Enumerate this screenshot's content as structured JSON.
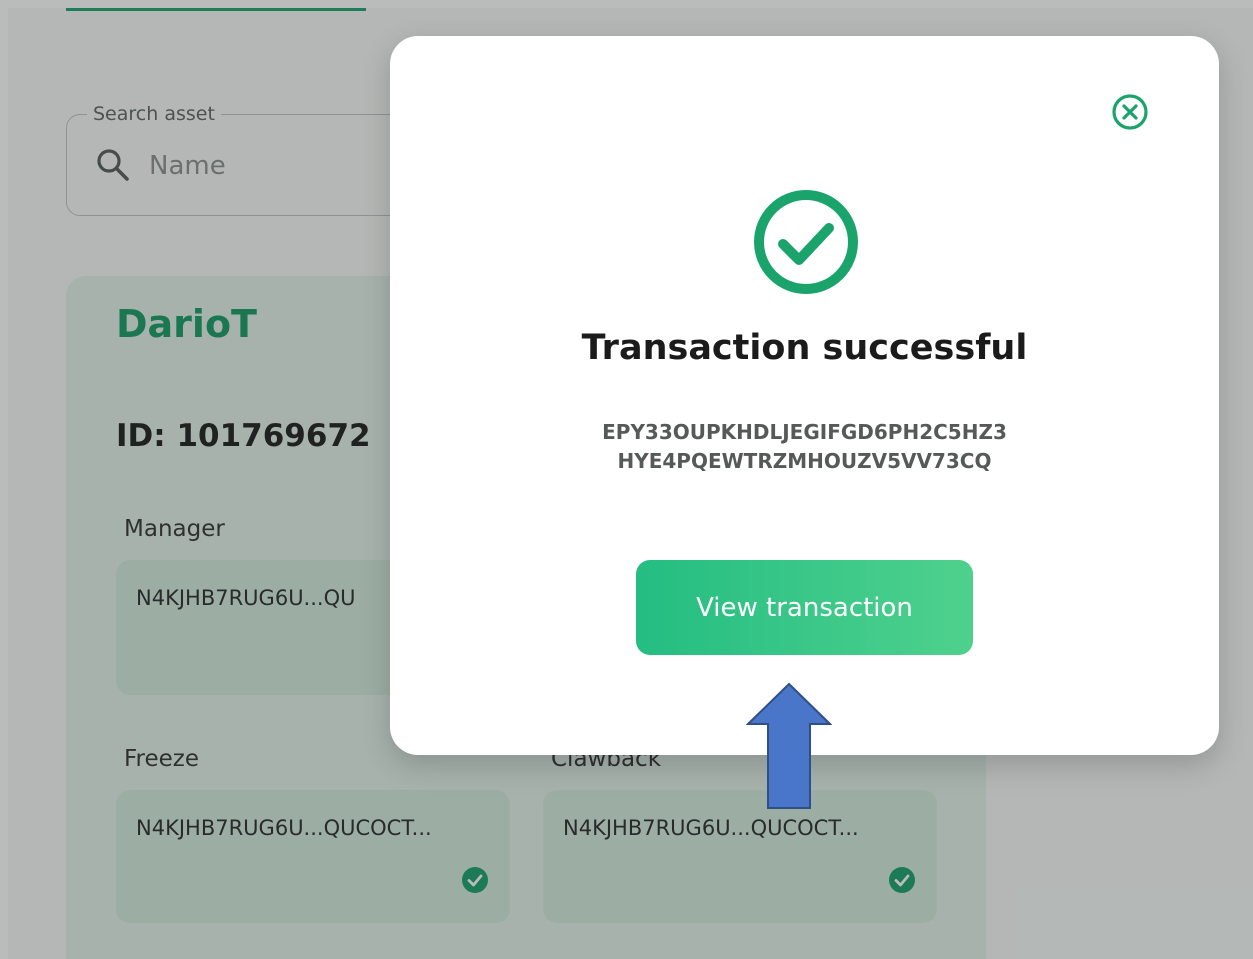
{
  "search": {
    "legend": "Search asset",
    "placeholder": "Name"
  },
  "asset": {
    "name": "DarioT",
    "id_text": "ID: 101769672",
    "fields": [
      {
        "label": "Manager",
        "value": "N4KJHB7RUG6U...QU"
      },
      {
        "label": "Freeze",
        "value": "N4KJHB7RUG6U...QUCOCT..."
      },
      {
        "label": "Clawback",
        "value": "N4KJHB7RUG6U...QUCOCT..."
      }
    ]
  },
  "modal": {
    "title": "Transaction successful",
    "tx_line1": "EPY33OUPKHDLJEGIFGD6PH2C5HZ3",
    "tx_line2": "HYE4PQEWTRZMHOUZV5VV73CQ",
    "button_label": "View transaction",
    "close_icon": "close-circle-icon",
    "status_icon": "check-circle-icon"
  },
  "annotation": {
    "type": "up-arrow",
    "color": "#4a76c9"
  },
  "colors": {
    "brand": "#17a06a",
    "button_start": "#24bd82",
    "button_end": "#4fd18d"
  }
}
